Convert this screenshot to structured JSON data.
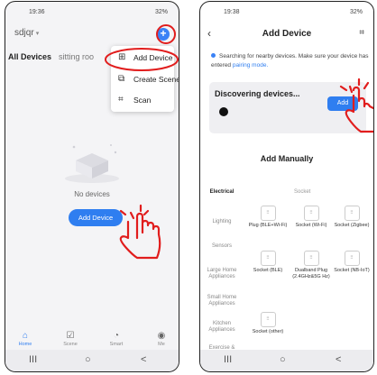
{
  "left_screen": {
    "status_time": "19:36",
    "status_right": "32%",
    "home_name": "sdjqr",
    "plus_icon": "add-icon",
    "tabs": [
      "All Devices",
      "sitting roo"
    ],
    "menu": [
      {
        "label": "Add Device",
        "icon": "add-device-icon"
      },
      {
        "label": "Create Scene",
        "icon": "create-scene-icon"
      },
      {
        "label": "Scan",
        "icon": "scan-icon"
      }
    ],
    "empty_text": "No devices",
    "add_device_button": "Add Device",
    "tabbar": [
      "Home",
      "Scene",
      "Smart",
      "Me"
    ]
  },
  "right_screen": {
    "status_time": "19:38",
    "status_right": "32%",
    "title": "Add Device",
    "searching_text": "Searching for nearby devices. Make sure your device has entered ",
    "searching_link": "pairing mode.",
    "discovering_label": "Discovering devices...",
    "add_button": "Add",
    "add_manually": "Add Manually",
    "section_head": "Socket",
    "categories": [
      "Electrical",
      "Lighting",
      "Sensors",
      "Large Home Appliances",
      "Small Home Appliances",
      "Kitchen Appliances",
      "Exercise &"
    ],
    "devices": [
      {
        "name": "Plug (BLE+Wi-Fi)"
      },
      {
        "name": "Socket (Wi-Fi)"
      },
      {
        "name": "Socket (Zigbee)"
      },
      {
        "name": "Socket (BLE)"
      },
      {
        "name": "Dualband Plug (2.4GHz&5G Hz)"
      },
      {
        "name": "Socket (NB-IoT)"
      },
      {
        "name": "Socket (other)"
      }
    ]
  },
  "nav_buttons": [
    "III",
    "○",
    "<"
  ],
  "colors": {
    "accent": "#2f7ef0",
    "annotation": "#e11d1d"
  }
}
